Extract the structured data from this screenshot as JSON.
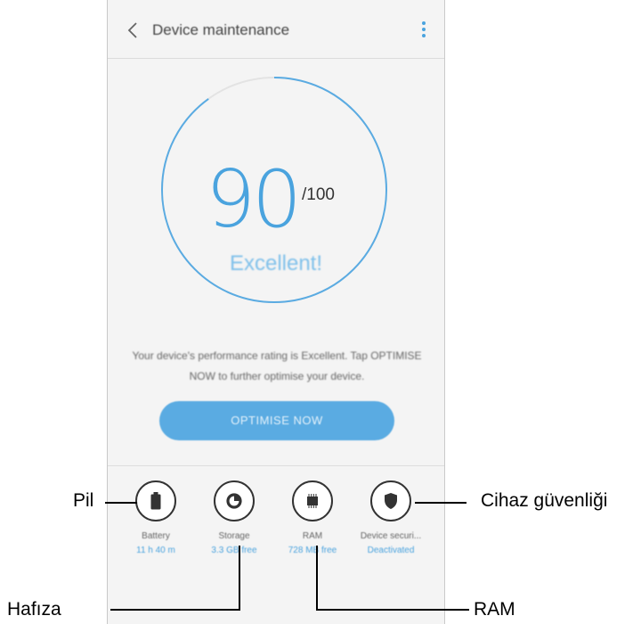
{
  "header": {
    "back_icon": "chevron-left-icon",
    "title": "Device maintenance",
    "more_icon": "more-vertical-icon"
  },
  "score": {
    "value": "90",
    "max": "/100",
    "rating": "Excellent!",
    "ring_fraction": 0.9
  },
  "description": "Your device's performance rating is Excellent. Tap OPTIMISE NOW to further optimise your device.",
  "optimise_button": "OPTIMISE NOW",
  "tools": [
    {
      "icon": "battery-icon",
      "label": "Battery",
      "value": "11 h 40 m"
    },
    {
      "icon": "storage-icon",
      "label": "Storage",
      "value": "3.3 GB free"
    },
    {
      "icon": "ram-chip-icon",
      "label": "RAM",
      "value": "728 MB free"
    },
    {
      "icon": "shield-icon",
      "label": "Device securi...",
      "value": "Deactivated"
    }
  ],
  "callouts": {
    "battery": "Pil",
    "storage": "Hafıza",
    "ram": "RAM",
    "security": "Cihaz güvenliği"
  },
  "colors": {
    "accent": "#4aa3de",
    "button": "#5aabe2",
    "background": "#f4f4f4"
  }
}
